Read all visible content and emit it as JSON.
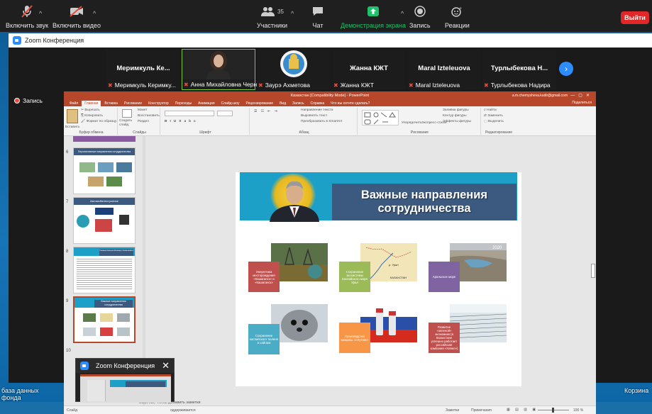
{
  "toolbar": {
    "mute_label": "Включить звук",
    "video_label": "Включить видео",
    "participants_label": "Участники",
    "participants_count": "35",
    "chat_label": "Чат",
    "share_label": "Демонстрация экрана",
    "record_label": "Запись",
    "reactions_label": "Реакции",
    "leave_label": "Выйти",
    "share_color": "#21c06a"
  },
  "zoom_window": {
    "title": "Zoom Конференция",
    "recording_label": "Запись"
  },
  "participants": [
    {
      "name": "Меримкуль  Ке...",
      "caption": "Меримкуль Керимку..."
    },
    {
      "name": "",
      "caption": "Анна Михайловна Черн..."
    },
    {
      "name": "",
      "caption": "Заурэ Ахметова"
    },
    {
      "name": "Жанна КЖТ",
      "caption": "Жанна КЖТ"
    },
    {
      "name": "Maral Izteleuova",
      "caption": "Maral Izteleuova"
    },
    {
      "name": "Турлыбекова  Н...",
      "caption": "Турлыбекова Надира"
    }
  ],
  "ppt": {
    "title": "Казахстан [Compatibility Mode]  -  PowerPoint",
    "account": "a.m.chernysheva.kudir@gmail.com",
    "share_label": "Поделиться",
    "tabs": [
      "Файл",
      "Главная",
      "Вставка",
      "Рисование",
      "Конструктор",
      "Переходы",
      "Анимация",
      "Слайд-шоу",
      "Рецензирование",
      "Вид",
      "Запись",
      "Справка",
      "Что вы хотите сделать?"
    ],
    "active_tab": "Главная",
    "ribbon": {
      "paste": "Вставить",
      "cut": "Вырезать",
      "copy": "Копировать",
      "format_painter": "Формат по образцу",
      "clipboard": "Буфер обмена",
      "new_slide": "Создать слайд",
      "layout": "Макет",
      "reset": "Восстановить",
      "section": "Раздел",
      "slides": "Слайды",
      "font": "Шрифт",
      "text_direction": "Направление текста",
      "align_text": "Выровнять текст",
      "smartart": "Преобразовать в SmartArt",
      "paragraph": "Абзац",
      "arrange": "Упорядочить",
      "quick_styles": "Экспресс-стили",
      "shape_fill": "Заливка фигуры",
      "shape_outline": "Контур фигуры",
      "shape_effects": "Эффекты фигуры",
      "drawing": "Рисование",
      "find": "Найти",
      "replace": "Заменить",
      "select": "Выделить",
      "editing": "Редактирование"
    },
    "slide_numbers": [
      "6",
      "7",
      "8",
      "9",
      "10"
    ],
    "thumb_titles": [
      "Перспективные направления сотрудничества",
      "Автомобилестроение",
      "Токаев Касым-Жомарт Кемелевич",
      "Важные направления сотрудничества"
    ],
    "notes_placeholder": "Заметки, чтобы добавить заметки",
    "status_notes": "Заметки",
    "status_comments": "Примечания",
    "zoom_level": "100 %",
    "status_left": "Слайд",
    "status_accessibility": "оддерживается"
  },
  "slide": {
    "title_line1": "Важные направления",
    "title_line2": "сотрудничества",
    "year_label": "2020",
    "cards": [
      {
        "label": "Энергетика месторождения «Кашаганск» и «Кашаганск»",
        "color": "#c0504d"
      },
      {
        "label": "Сохранение экосистемы Каспийского моря Урал",
        "color": "#9bbb59"
      },
      {
        "label": "Аральское море",
        "color": "#8064a2"
      },
      {
        "label": "Сохранение каспийского тюленя и сайгака",
        "color": "#4bacc6"
      },
      {
        "label": "Производство вакцины «Спутник»",
        "color": "#f79646"
      },
      {
        "label": "Развитие «зеленой» экономики (в Казахстане успешно работает российская компания «Хевел»)",
        "color": "#c0504d"
      }
    ],
    "map_labels": [
      "р. Урал",
      "КАЗАХСТАН"
    ]
  },
  "desktop": {
    "bottom_left": "база данных фонда",
    "bottom_right": "Корзина"
  },
  "mini_window": {
    "title": "Zoom Конференция"
  }
}
